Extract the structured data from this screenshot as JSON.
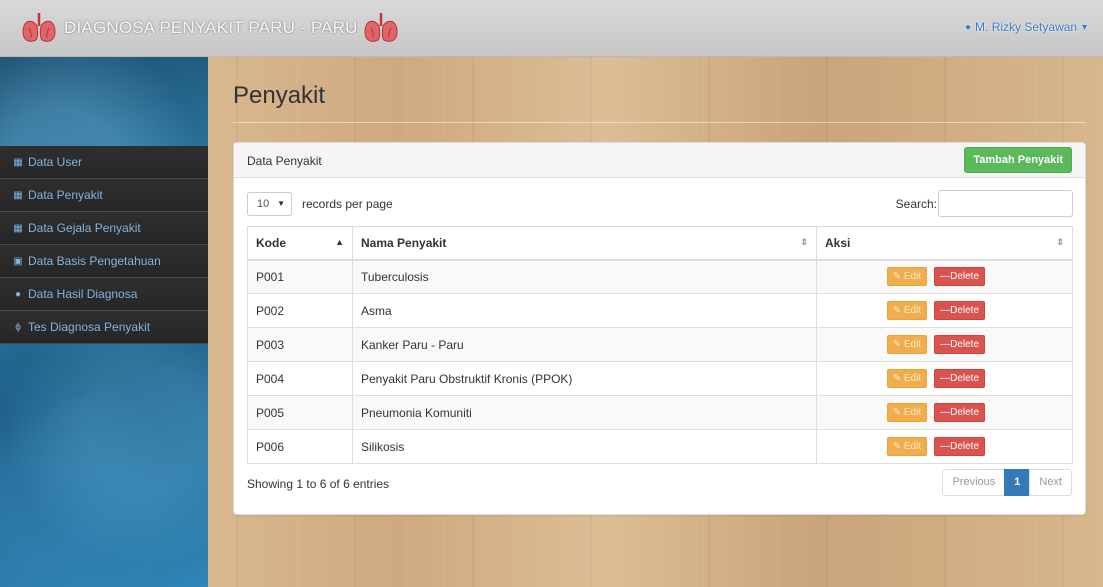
{
  "navbar": {
    "brand": "DIAGNOSA PENYAKIT PARU - PARU",
    "user": "M. Rizky Setyawan",
    "logo_icon": "lungs-icon",
    "user_icon": "user-icon"
  },
  "sidebar": {
    "items": [
      {
        "label": "Data User",
        "icon": "table-icon"
      },
      {
        "label": "Data Penyakit",
        "icon": "table-icon"
      },
      {
        "label": "Data Gejala Penyakit",
        "icon": "table-icon"
      },
      {
        "label": "Data Basis Pengetahuan",
        "icon": "camera-icon"
      },
      {
        "label": "Data Hasil Diagnosa",
        "icon": "users-icon"
      },
      {
        "label": "Tes Diagnosa Penyakit",
        "icon": "stethoscope-icon"
      }
    ]
  },
  "main": {
    "title": "Penyakit",
    "panel_title": "Data Penyakit",
    "add_button": "Tambah Penyakit",
    "page_length": "10",
    "page_length_label": "records per page",
    "search_label": "Search:",
    "search_value": "",
    "columns": [
      "Kode",
      "Nama Penyakit",
      "Aksi"
    ],
    "rows": [
      {
        "kode": "P001",
        "nama": "Tuberculosis"
      },
      {
        "kode": "P002",
        "nama": "Asma"
      },
      {
        "kode": "P003",
        "nama": "Kanker Paru - Paru"
      },
      {
        "kode": "P004",
        "nama": "Penyakit Paru Obstruktif Kronis (PPOK)"
      },
      {
        "kode": "P005",
        "nama": "Pneumonia Komuniti"
      },
      {
        "kode": "P006",
        "nama": "Silikosis"
      }
    ],
    "edit_label": "Edit",
    "delete_label": "Delete",
    "info": "Showing 1 to 6 of 6 entries",
    "pagination": {
      "previous": "Previous",
      "current": "1",
      "next": "Next"
    }
  },
  "colors": {
    "add_button": "#5cb85c",
    "edit_button": "#f0ad4e",
    "delete_button": "#d9534f",
    "page_active": "#337ab7",
    "sidebar_text": "#7fb3e0"
  }
}
